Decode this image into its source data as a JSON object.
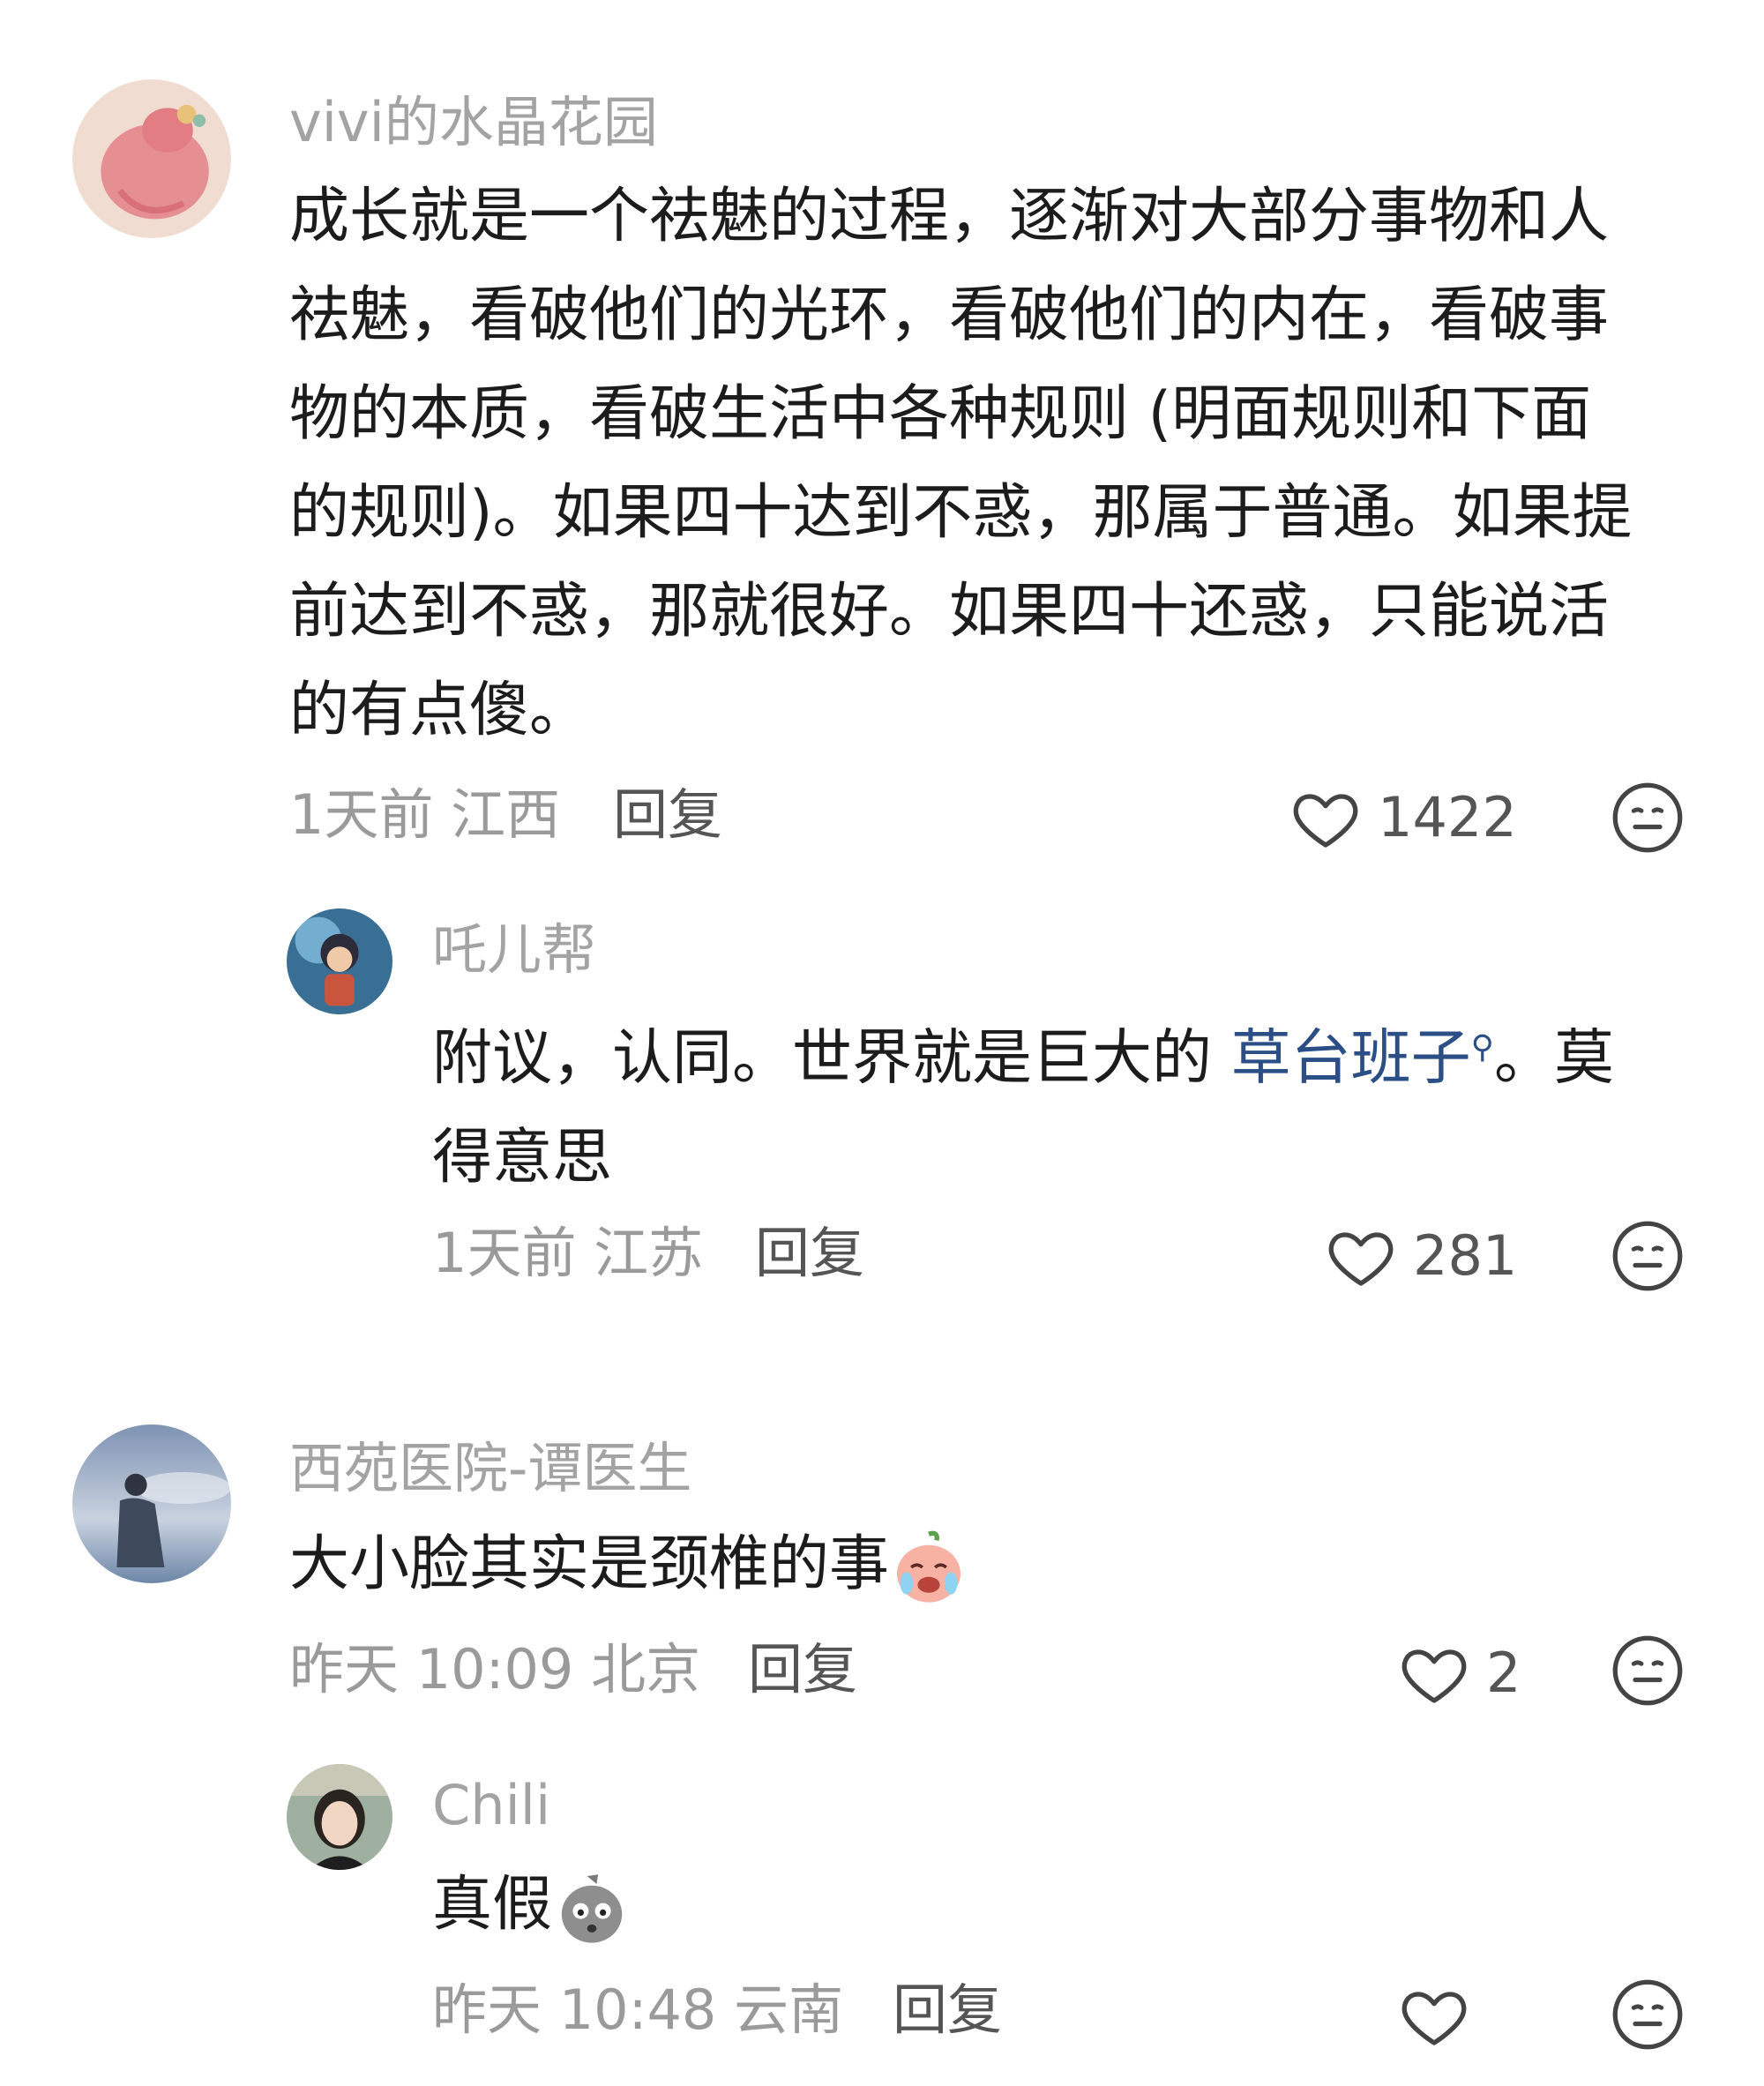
{
  "comments": [
    {
      "username": "vivi的水晶花园",
      "lines": [
        "成长就是一个祛魅的过程，逐渐对大部分事物和人",
        "祛魅，看破他们的光环，看破他们的内在，看破事",
        "物的本质，看破生活中各种规则 (明面规则和下面",
        "的规则)。如果四十达到不惑，那属于普通。如果提",
        "前达到不惑，那就很好。如果四十还惑，只能说活",
        "的有点傻。"
      ],
      "time_location": "1天前 江西",
      "reply_label": "回复",
      "likes": "1422",
      "avatar_icon": "pink-flamingo-avatar",
      "replies": [
        {
          "username": "吒儿帮",
          "text_before": "附议，认同。世界就是巨大的 ",
          "link_text": "草台班子",
          "text_after": "。莫",
          "line2": "得意思",
          "time_location": "1天前 江苏",
          "reply_label": "回复",
          "likes": "281",
          "avatar_icon": "cartoon-character-avatar"
        }
      ]
    },
    {
      "username": "西苑医院-谭医生",
      "text": "大小脸其实是颈椎的事",
      "emoji": "crying-laughing-emoji",
      "time_location": "昨天 10:09 北京",
      "reply_label": "回复",
      "likes": "2",
      "avatar_icon": "person-sky-avatar",
      "replies": [
        {
          "username": "Chili",
          "text": "真假",
          "emoji": "shocked-gray-emoji",
          "time_location": "昨天 10:48 云南",
          "reply_label": "回复",
          "likes": "",
          "avatar_icon": "woman-portrait-avatar"
        }
      ]
    }
  ],
  "colors": {
    "username": "#a3a3a3",
    "text": "#1c1c1c",
    "meta": "#9a9a9a",
    "link": "#2a4e85"
  }
}
